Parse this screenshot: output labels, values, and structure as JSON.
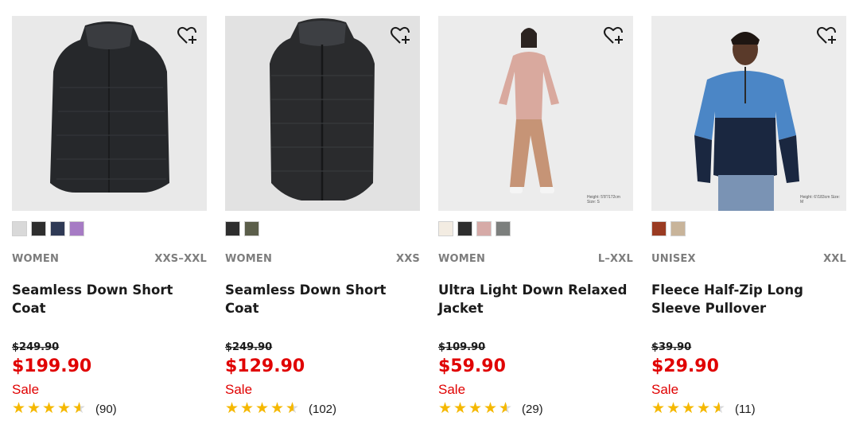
{
  "products": [
    {
      "gender": "WOMEN",
      "sizes": "XXS–XXL",
      "name": "Seamless Down Short Coat",
      "original_price": "$249.90",
      "sale_price": "$199.90",
      "sale_label": "Sale",
      "rating": 4.5,
      "review_count": "(90)",
      "swatches": [
        "#d9d9d9",
        "#2e2e2e",
        "#2f3a55",
        "#a67bc4"
      ],
      "caption": ""
    },
    {
      "gender": "WOMEN",
      "sizes": "XXS",
      "name": "Seamless Down Short Coat",
      "original_price": "$249.90",
      "sale_price": "$129.90",
      "sale_label": "Sale",
      "rating": 4.5,
      "review_count": "(102)",
      "swatches": [
        "#2e2e2e",
        "#5b5e4a"
      ],
      "caption": ""
    },
    {
      "gender": "WOMEN",
      "sizes": "L–XXL",
      "name": "Ultra Light Down Relaxed Jacket",
      "original_price": "$109.90",
      "sale_price": "$59.90",
      "sale_label": "Sale",
      "rating": 4.5,
      "review_count": "(29)",
      "swatches": [
        "#f3ece2",
        "#2e2e2e",
        "#d6aaa7",
        "#7c7f7d"
      ],
      "caption": "Height: 5'8\"/172cm Size: S"
    },
    {
      "gender": "UNISEX",
      "sizes": "XXL",
      "name": "Fleece Half-Zip Long Sleeve Pullover",
      "original_price": "$39.90",
      "sale_price": "$29.90",
      "sale_label": "Sale",
      "rating": 4.5,
      "review_count": "(11)",
      "swatches": [
        "#9a3b22",
        "#c8b49a"
      ],
      "caption": "Height: 6'/183cm Size: M"
    }
  ],
  "icons": {
    "wishlist": "heart-plus-icon",
    "star": "star-icon"
  },
  "colors": {
    "sale": "#e00000",
    "star": "#f5b800",
    "meta": "#7d7d7d"
  }
}
